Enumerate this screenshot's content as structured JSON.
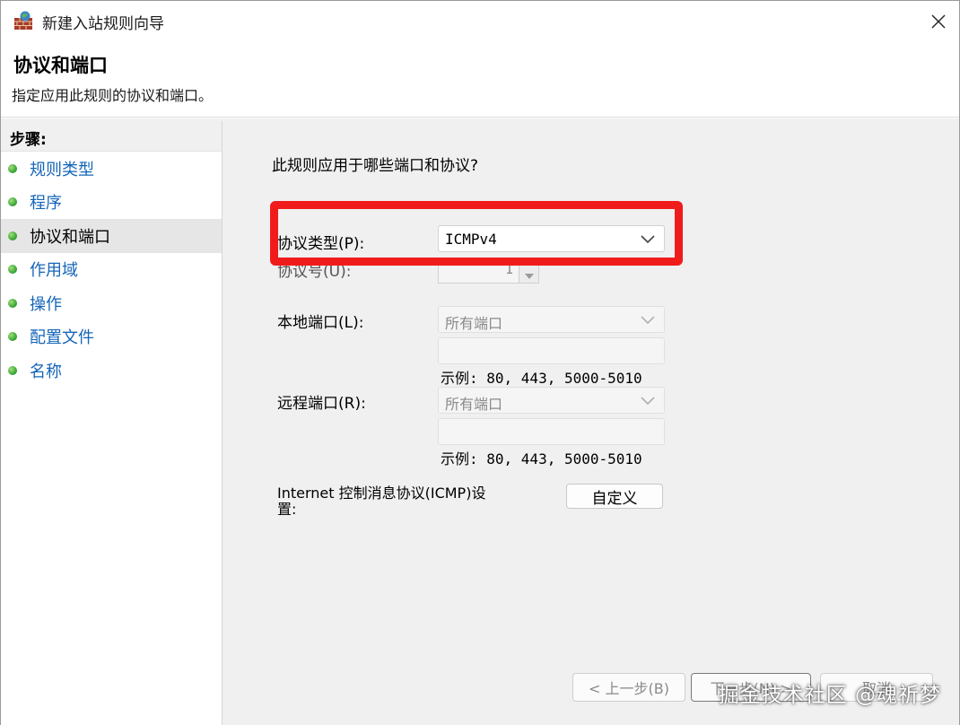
{
  "window": {
    "title": "新建入站规则向导"
  },
  "header": {
    "title": "协议和端口",
    "subtitle": "指定应用此规则的协议和端口。"
  },
  "steps": {
    "heading": "步骤:",
    "items": [
      {
        "label": "规则类型",
        "active": false
      },
      {
        "label": "程序",
        "active": false
      },
      {
        "label": "协议和端口",
        "active": true
      },
      {
        "label": "作用域",
        "active": false
      },
      {
        "label": "操作",
        "active": false
      },
      {
        "label": "配置文件",
        "active": false
      },
      {
        "label": "名称",
        "active": false
      }
    ]
  },
  "content": {
    "question": "此规则应用于哪些端口和协议?",
    "protocol_type": {
      "label": "协议类型(P):",
      "value": "ICMPv4"
    },
    "protocol_number": {
      "label": "协议号(U):",
      "value": "1"
    },
    "local_port": {
      "label": "本地端口(L):",
      "value": "所有端口",
      "example": "示例: 80, 443, 5000-5010"
    },
    "remote_port": {
      "label": "远程端口(R):",
      "value": "所有端口",
      "example": "示例: 80, 443, 5000-5010"
    },
    "icmp": {
      "label_line1": "Internet 控制消息协议(ICMP)设",
      "label_line2": "置:",
      "button": "自定义"
    }
  },
  "footer": {
    "back": "< 上一步(B)",
    "next": "下一步(N) >",
    "cancel": "取消"
  },
  "watermark": "掘金技术社区 @魂祈梦",
  "colors": {
    "highlight": "#f01c1c",
    "step_link": "#1565b8",
    "step_dot": "#2f9e2f"
  }
}
